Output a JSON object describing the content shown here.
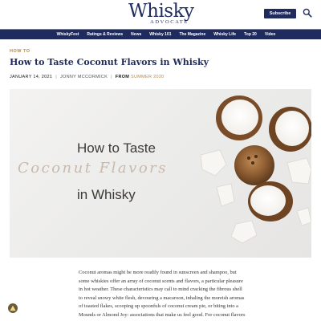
{
  "header": {
    "logo_main": "Whisky",
    "logo_sub": "ADVOCATE",
    "subscribe_label": "Subscribe",
    "search_icon": "search-icon"
  },
  "nav": {
    "items": [
      "WhiskyFest",
      "Ratings & Reviews",
      "News",
      "Whisky 101",
      "The Magazine",
      "Whisky Life",
      "Top 20",
      "Video"
    ]
  },
  "article": {
    "category": "HOW TO",
    "title": "How to Taste Coconut Flavors in Whisky",
    "date": "JANUARY 14, 2021",
    "author": "JONNY MCCORMICK",
    "from_label": "FROM",
    "issue": "SUMMER 2020",
    "separator": "|"
  },
  "hero": {
    "line1": "How to Taste",
    "line2": "Coconut Flavors",
    "line3": "in Whisky"
  },
  "body": {
    "paragraph": "Coconut aromas might be more readily found in sunscreen and shampoo, but some whiskies offer an array of coconut scents and flavors, a particular pleasure in hot weather. These characteristics may call to mind cracking the fibrous shell to reveal snowy white flesh, devouring a macaroon, inhaling the moreish aromas of toasted flakes, scooping up spoonfuls of coconut cream pie, or biting into a Mounds or Almond Joy: associations that make us feel good. For coconut flavors in whisky, however, the journey"
  },
  "colors": {
    "navy": "#1f2b5c",
    "gold": "#b5884a"
  }
}
